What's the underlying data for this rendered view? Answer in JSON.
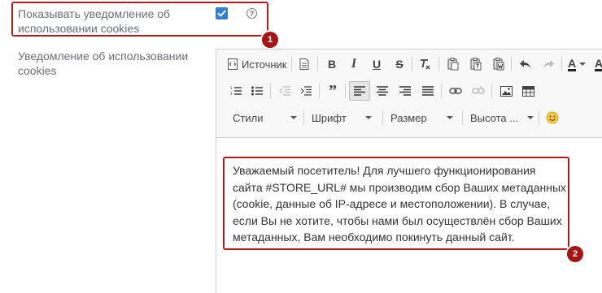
{
  "setting1": {
    "label": "Показывать уведомление об использовании cookies",
    "checked": true
  },
  "setting2": {
    "label": "Уведомление об использовании cookies"
  },
  "badges": [
    "1",
    "2"
  ],
  "toolbar": {
    "source_label": "Источник",
    "format_combos": [
      "Стили",
      "Шрифт",
      "Размер",
      "Высота ..."
    ]
  },
  "editor": {
    "text": "Уважаемый посетитель! Для лучшего функционирования сайта #STORE_URL# мы производим сбор Ваших метаданных (cookie, данные об IP-адресе и местоположении). В случае, если Вы не хотите, чтобы нами был осуществлён сбор Ваших метаданных, Вам необходимо покинуть данный сайт."
  },
  "colors": {
    "highlight": "#b01c1c",
    "badge": "#a51515",
    "checkbox": "#2e7fd6"
  }
}
